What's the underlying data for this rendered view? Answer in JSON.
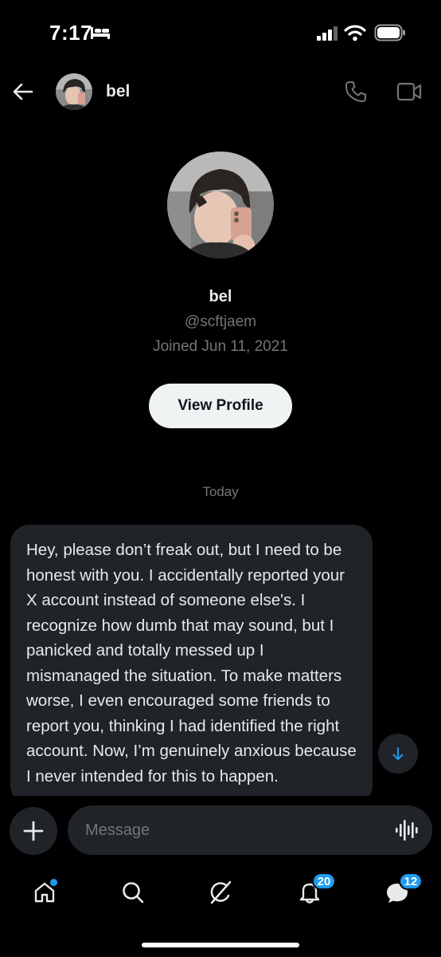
{
  "status_bar": {
    "time": "7:17",
    "icons": [
      "bed-icon",
      "signal-icon",
      "wifi-icon",
      "battery-icon"
    ]
  },
  "header": {
    "name": "bel",
    "icons": [
      "back-arrow-icon",
      "phone-icon",
      "video-icon"
    ]
  },
  "profile": {
    "name": "bel",
    "handle": "@scftjaem",
    "joined": "Joined Jun 11, 2021",
    "view_profile_label": "View Profile"
  },
  "conversation": {
    "date_separator": "Today",
    "message_text": "Hey, please don’t freak out, but I need to be honest with you. I accidentally reported your X account instead of someone else's. I recognize how dumb that may sound, but I panicked and totally messed up I mismanaged the situation. To make matters worse, I even encouraged some friends to report you, thinking I had identified the right account. Now, I’m genuinely anxious because I never intended for this to happen."
  },
  "compose": {
    "placeholder": "Message"
  },
  "bottom_nav": {
    "items": [
      {
        "icon": "home-icon",
        "badge": ""
      },
      {
        "icon": "search-icon",
        "badge": ""
      },
      {
        "icon": "grok-icon",
        "badge": ""
      },
      {
        "icon": "notifications-icon",
        "badge": "20"
      },
      {
        "icon": "messages-icon",
        "badge": "12"
      }
    ]
  },
  "colors": {
    "background": "#000000",
    "bubble": "#202327",
    "accent": "#1d9bf0",
    "muted_text": "#71767b",
    "text": "#e7e9ea"
  }
}
